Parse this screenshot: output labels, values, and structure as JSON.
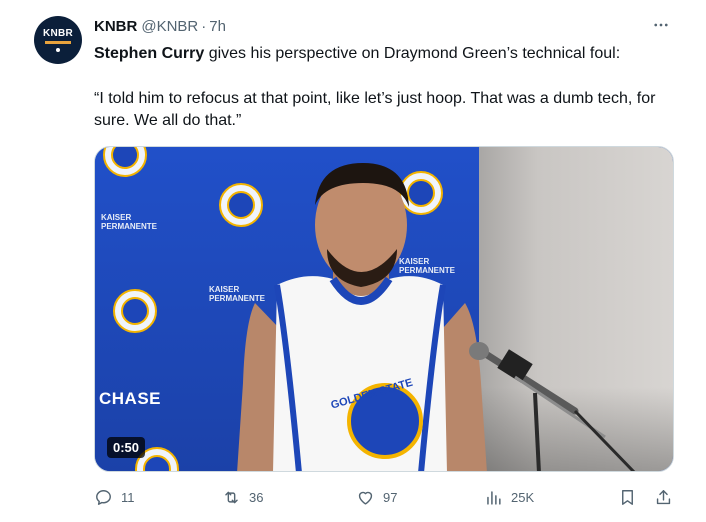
{
  "tweet": {
    "author": {
      "name": "KNBR",
      "handle": "@KNBR",
      "separator": "·",
      "time": "7h",
      "avatar_text": "KNBR"
    },
    "body": {
      "bold_name": "Stephen Curry",
      "line1_rest": " gives his perspective on Draymond Green’s technical foul:",
      "quote": "“I told him to refocus at that point, like let’s just hoop. That was a dumb tech, for sure. We all do that.”"
    },
    "media": {
      "duration": "0:50",
      "backdrop_sponsor_1": "KAISER PERMANENTE",
      "backdrop_sponsor_2": "CHASE",
      "jersey_text": "GOLDEN STATE",
      "colors": {
        "backdrop_blue": "#1d46b8",
        "warriors_gold": "#f4b400",
        "wall": "#d0cdca"
      }
    },
    "actions": {
      "reply_count": "11",
      "retweet_count": "36",
      "like_count": "97",
      "views_count": "25K"
    },
    "icons": {
      "more": "more-icon",
      "reply": "reply-icon",
      "retweet": "retweet-icon",
      "like": "heart-icon",
      "views": "views-icon",
      "bookmark": "bookmark-icon",
      "share": "share-icon"
    },
    "colors": {
      "text": "#0f1419",
      "secondary": "#536471"
    }
  }
}
